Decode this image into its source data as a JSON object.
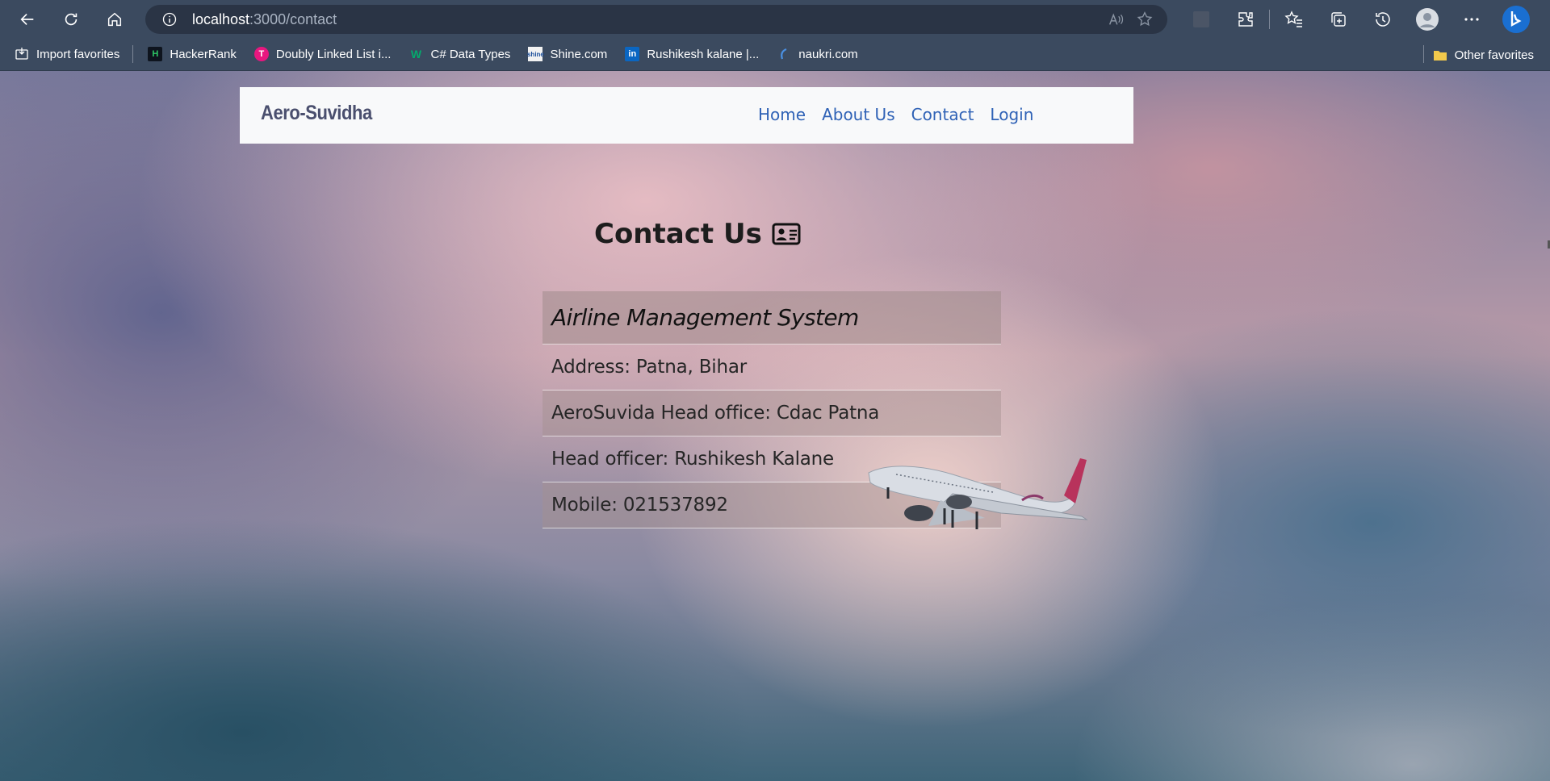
{
  "browser": {
    "url_host": "localhost",
    "url_path": ":3000/contact"
  },
  "bookmarks": {
    "items": [
      {
        "label": "Import favorites",
        "icon": "import-icon"
      },
      {
        "label": "HackerRank",
        "icon": "hackerrank-icon"
      },
      {
        "label": "Doubly Linked List i...",
        "icon": "doubly-icon"
      },
      {
        "label": "C# Data Types",
        "icon": "w-icon"
      },
      {
        "label": "Shine.com",
        "icon": "shine-icon"
      },
      {
        "label": "Rushikesh kalane |...",
        "icon": "linkedin-icon"
      },
      {
        "label": "naukri.com",
        "icon": "naukri-icon"
      }
    ],
    "other": "Other favorites"
  },
  "navbar": {
    "brand": "Aero-Suvidha",
    "links": [
      "Home",
      "About Us",
      "Contact",
      "Login"
    ]
  },
  "contact": {
    "title": "Contact Us",
    "header": "Airline Management System",
    "rows": [
      "Address: Patna, Bihar",
      "AeroSuvida Head office: Cdac Patna",
      "Head officer: Rushikesh Kalane",
      "Mobile: 021537892"
    ]
  },
  "colors": {
    "browser_bar": "#3b4a5f",
    "nav_link": "#2f62b6",
    "brand": "#4a4f6e"
  }
}
